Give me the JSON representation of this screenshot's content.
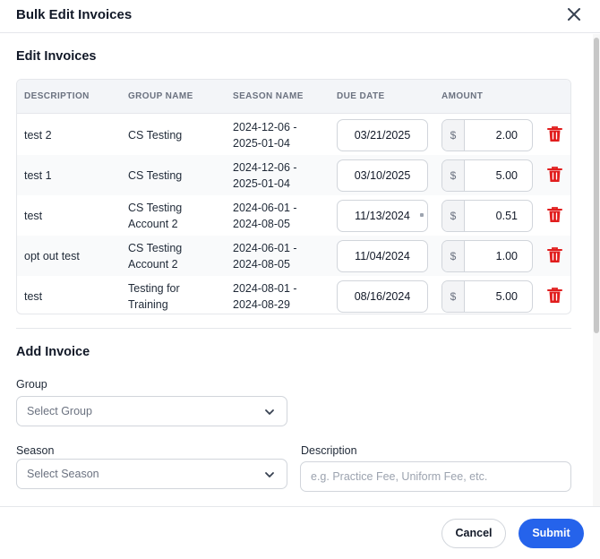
{
  "modal": {
    "title": "Bulk Edit Invoices"
  },
  "edit_section": {
    "title": "Edit Invoices",
    "columns": [
      "DESCRIPTION",
      "GROUP NAME",
      "SEASON NAME",
      "DUE DATE",
      "AMOUNT"
    ],
    "currency_symbol": "$",
    "rows": [
      {
        "description": "test 2",
        "group": [
          "CS Testing"
        ],
        "season": [
          "2024-12-06 -",
          "2025-01-04"
        ],
        "due_date": "03/21/2025",
        "amount": "2.00"
      },
      {
        "description": "test 1",
        "group": [
          "CS Testing"
        ],
        "season": [
          "2024-12-06 -",
          "2025-01-04"
        ],
        "due_date": "03/10/2025",
        "amount": "5.00"
      },
      {
        "description": "test",
        "group": [
          "CS Testing",
          "Account 2"
        ],
        "season": [
          "2024-06-01 -",
          "2024-08-05"
        ],
        "due_date": "11/13/2024",
        "amount": "0.51"
      },
      {
        "description": "opt out test",
        "group": [
          "CS Testing",
          "Account 2"
        ],
        "season": [
          "2024-06-01 -",
          "2024-08-05"
        ],
        "due_date": "11/04/2024",
        "amount": "1.00"
      },
      {
        "description": "test",
        "group": [
          "Testing for",
          "Training"
        ],
        "season": [
          "2024-08-01 -",
          "2024-08-29"
        ],
        "due_date": "08/16/2024",
        "amount": "5.00"
      }
    ]
  },
  "add_section": {
    "title": "Add Invoice",
    "group_label": "Group",
    "group_placeholder": "Select Group",
    "season_label": "Season",
    "season_placeholder": "Select Season",
    "description_label": "Description",
    "description_placeholder": "e.g. Practice Fee, Uniform Fee, etc."
  },
  "footer": {
    "cancel_label": "Cancel",
    "submit_label": "Submit"
  },
  "colors": {
    "primary": "#2563eb",
    "delete": "#e11d1d"
  },
  "icons": {
    "close": "close-icon",
    "delete": "trash-icon",
    "dropdown": "chevron-down-icon"
  }
}
